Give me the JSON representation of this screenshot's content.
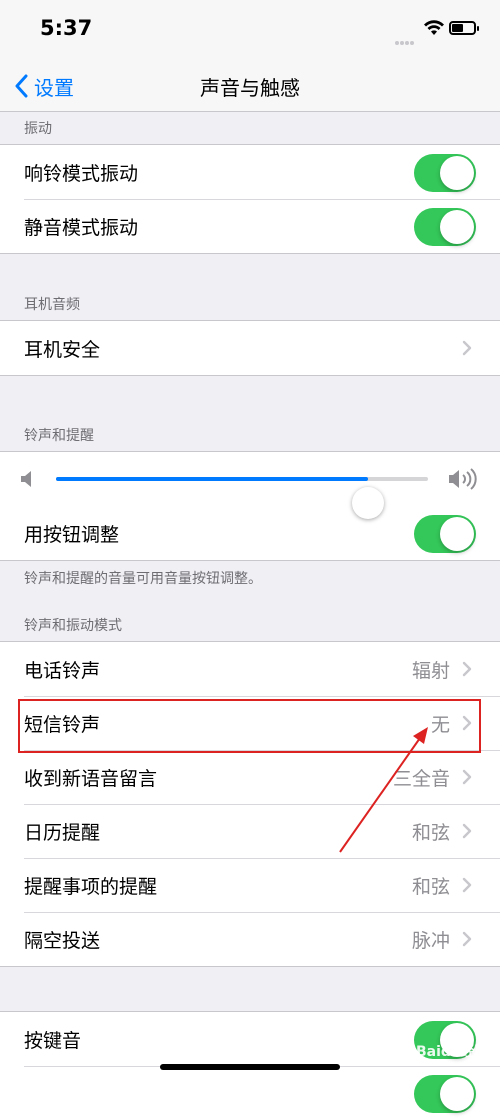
{
  "status_bar": {
    "time": "5:37"
  },
  "nav": {
    "back_label": "设置",
    "title": "声音与触感"
  },
  "vibration": {
    "header": "振动",
    "ring_vibrate": {
      "label": "响铃模式振动",
      "on": true
    },
    "silent_vibrate": {
      "label": "静音模式振动",
      "on": true
    }
  },
  "headphone": {
    "header": "耳机音频",
    "safety_label": "耳机安全"
  },
  "ringer_alerts": {
    "header": "铃声和提醒",
    "volume_fraction": 0.84,
    "change_with_buttons": {
      "label": "用按钮调整",
      "on": true
    },
    "footer": "铃声和提醒的音量可用音量按钮调整。"
  },
  "sounds_patterns": {
    "header": "铃声和振动模式",
    "items": [
      {
        "label": "电话铃声",
        "value": "辐射"
      },
      {
        "label": "短信铃声",
        "value": "无"
      },
      {
        "label": "收到新语音留言",
        "value": "三全音"
      },
      {
        "label": "日历提醒",
        "value": "和弦"
      },
      {
        "label": "提醒事项的提醒",
        "value": "和弦"
      },
      {
        "label": "隔空投送",
        "value": "脉冲"
      }
    ]
  },
  "keyboard": {
    "clicks": {
      "label": "按键音",
      "on": true
    }
  },
  "watermark_text": "Baidu经验",
  "colors": {
    "accent": "#007aff",
    "toggle_on": "#34c759",
    "annotation": "#dd2222"
  },
  "icons": [
    "chevron-left-icon",
    "wifi-icon",
    "battery-icon",
    "speaker-low-icon",
    "speaker-high-icon",
    "chevron-right-icon"
  ]
}
